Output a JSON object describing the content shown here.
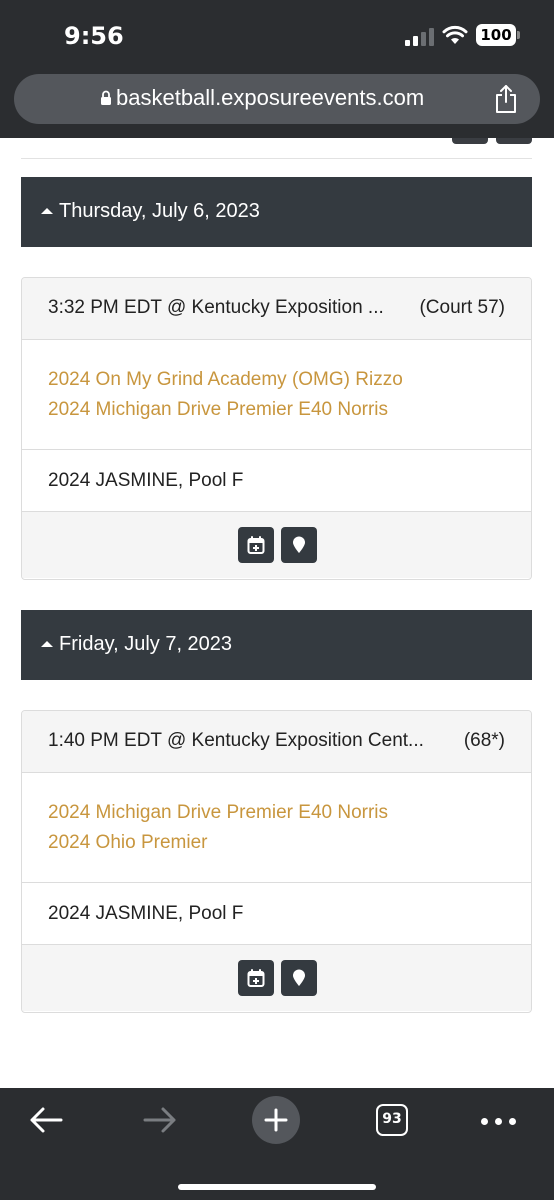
{
  "status_bar": {
    "time": "9:56",
    "battery": "100"
  },
  "browser": {
    "url": "basketball.exposureevents.com",
    "tab_count": "93"
  },
  "days": [
    {
      "date": "Thursday, July 6, 2023",
      "game": {
        "time_location": "3:32 PM EDT @ Kentucky Exposition ...",
        "court": "(Court 57)",
        "team1": "2024 On My Grind Academy (OMG) Rizzo",
        "team2": "2024 Michigan Drive Premier E40 Norris",
        "pool": "2024 JASMINE, Pool F"
      }
    },
    {
      "date": "Friday, July 7, 2023",
      "game": {
        "time_location": "1:40 PM EDT @ Kentucky Exposition Cent...",
        "court": "(68*)",
        "team1": "2024 Michigan Drive Premier E40 Norris",
        "team2": "2024 Ohio Premier",
        "pool": "2024 JASMINE, Pool F"
      }
    }
  ],
  "icons": {
    "calendar": "calendar-plus-icon",
    "map": "map-marker-icon"
  },
  "colors": {
    "header_bg": "#343a40",
    "team_link": "#c8963e",
    "chrome_bg": "#2b2d30"
  }
}
